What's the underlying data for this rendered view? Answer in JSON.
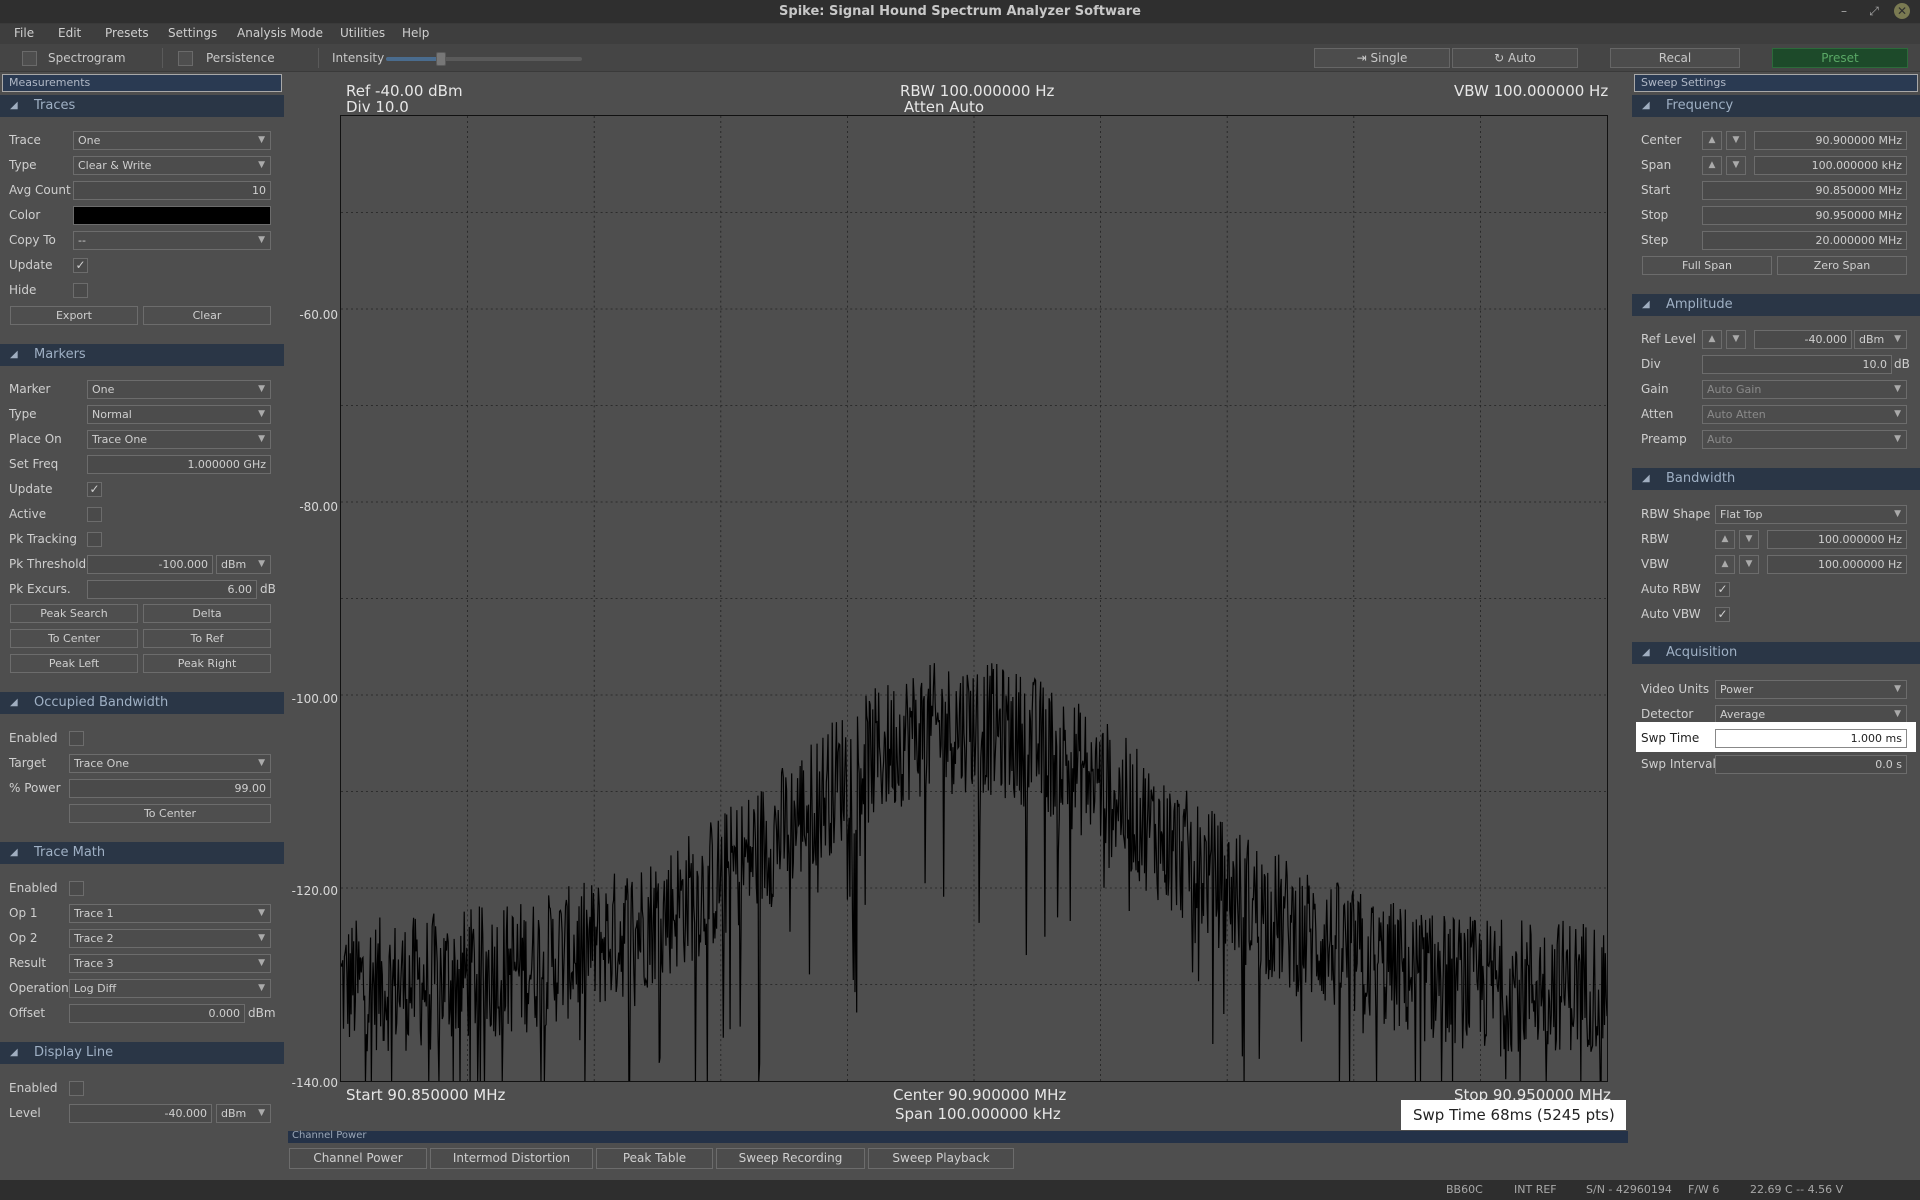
{
  "window": {
    "title": "Spike: Signal Hound Spectrum Analyzer Software"
  },
  "menu": [
    "File",
    "Edit",
    "Presets",
    "Settings",
    "Analysis Mode",
    "Utilities",
    "Help"
  ],
  "toolbar": {
    "spectrogram": "Spectrogram",
    "persistence": "Persistence",
    "intensity": "Intensity",
    "intensity_level": 0.28,
    "single": "Single",
    "auto": "Auto",
    "recal": "Recal",
    "preset": "Preset"
  },
  "left": {
    "tab": "Measurements",
    "traces": {
      "header": "Traces",
      "trace_label": "Trace",
      "trace": "One",
      "type_label": "Type",
      "type": "Clear & Write",
      "avg_label": "Avg Count",
      "avg": "10",
      "color_label": "Color",
      "copy_label": "Copy To",
      "copy": "--",
      "update_label": "Update",
      "hide_label": "Hide",
      "export": "Export",
      "clear": "Clear"
    },
    "markers": {
      "header": "Markers",
      "marker_label": "Marker",
      "marker": "One",
      "type_label": "Type",
      "type": "Normal",
      "place_label": "Place On",
      "place": "Trace One",
      "setfreq_label": "Set Freq",
      "setfreq": "1.000000 GHz",
      "update_label": "Update",
      "active_label": "Active",
      "pktrack_label": "Pk Tracking",
      "pkthresh_label": "Pk Threshold",
      "pkthresh": "-100.000",
      "pkthresh_unit": "dBm",
      "pkexc_label": "Pk Excurs.",
      "pkexc": "6.00",
      "pkexc_unit": "dB",
      "peak_search": "Peak Search",
      "delta": "Delta",
      "to_center": "To Center",
      "to_ref": "To Ref",
      "peak_left": "Peak Left",
      "peak_right": "Peak Right"
    },
    "obw": {
      "header": "Occupied Bandwidth",
      "enabled_label": "Enabled",
      "target_label": "Target",
      "target": "Trace One",
      "power_label": "% Power",
      "power": "99.00",
      "to_center": "To Center"
    },
    "tracemath": {
      "header": "Trace Math",
      "enabled_label": "Enabled",
      "op1_label": "Op 1",
      "op1": "Trace 1",
      "op2_label": "Op 2",
      "op2": "Trace 2",
      "result_label": "Result",
      "result": "Trace 3",
      "operation_label": "Operation",
      "operation": "Log Diff",
      "offset_label": "Offset",
      "offset": "0.000",
      "offset_unit": "dBm"
    },
    "displayline": {
      "header": "Display Line",
      "enabled_label": "Enabled",
      "level_label": "Level",
      "level": "-40.000",
      "level_unit": "dBm"
    }
  },
  "right": {
    "tab": "Sweep Settings",
    "frequency": {
      "header": "Frequency",
      "center_label": "Center",
      "center": "90.900000 MHz",
      "span_label": "Span",
      "span": "100.000000 kHz",
      "start_label": "Start",
      "start": "90.850000 MHz",
      "stop_label": "Stop",
      "stop": "90.950000 MHz",
      "step_label": "Step",
      "step": "20.000000 MHz",
      "full_span": "Full Span",
      "zero_span": "Zero Span"
    },
    "amplitude": {
      "header": "Amplitude",
      "ref_label": "Ref Level",
      "ref": "-40.000",
      "ref_unit": "dBm",
      "div_label": "Div",
      "div": "10.0",
      "div_unit": "dB",
      "gain_label": "Gain",
      "gain": "Auto Gain",
      "atten_label": "Atten",
      "atten": "Auto Atten",
      "preamp_label": "Preamp",
      "preamp": "Auto"
    },
    "bandwidth": {
      "header": "Bandwidth",
      "shape_label": "RBW Shape",
      "shape": "Flat Top",
      "rbw_label": "RBW",
      "rbw": "100.000000 Hz",
      "vbw_label": "VBW",
      "vbw": "100.000000 Hz",
      "autorbw_label": "Auto RBW",
      "autovbw_label": "Auto VBW"
    },
    "acquisition": {
      "header": "Acquisition",
      "video_label": "Video Units",
      "video": "Power",
      "detector_label": "Detector",
      "detector": "Average",
      "swptime_label": "Swp Time",
      "swptime": "1.000 ms",
      "swpint_label": "Swp Interval",
      "swpint": "0.0 s"
    }
  },
  "plot": {
    "ref": "Ref -40.00 dBm",
    "div": "Div 10.0",
    "rbw": "RBW 100.000000 Hz",
    "atten": "Atten Auto",
    "vbw": "VBW 100.000000 Hz",
    "start": "Start 90.850000 MHz",
    "center": "Center 90.900000 MHz",
    "span": "Span 100.000000 kHz",
    "stop": "Stop 90.950000 MHz",
    "swp_time": "Swp Time 68ms (5245 pts)",
    "y_ticks": [
      "-60.00",
      "-80.00",
      "-100.00",
      "-120.00",
      "-140.00"
    ]
  },
  "chart_data": {
    "type": "line",
    "x_range": [
      90.85,
      90.95
    ],
    "ylim": [
      -140,
      -40
    ],
    "grid": true,
    "series": [
      {
        "x": [
          90.85,
          90.855,
          90.86,
          90.865,
          90.87,
          90.875,
          90.88,
          90.885,
          90.89,
          90.895,
          90.9,
          90.905,
          90.91,
          90.915,
          90.92,
          90.925,
          90.93,
          90.935,
          90.94,
          90.945,
          90.95
        ],
        "values": [
          -130,
          -130,
          -129,
          -128,
          -126,
          -123,
          -119,
          -114,
          -108,
          -104,
          -103,
          -105,
          -109,
          -115,
          -120,
          -124,
          -127,
          -129,
          -130,
          -130,
          -130
        ]
      }
    ],
    "line_color": "#000000"
  },
  "bottom_tabs": {
    "strip": "Channel Power",
    "tabs": [
      "Channel Power",
      "Intermod Distortion",
      "Peak Table",
      "Sweep Recording",
      "Sweep Playback"
    ]
  },
  "status": {
    "device": "BB60C",
    "ref": "INT REF",
    "sn": "S/N - 42960194",
    "fw": "F/W 6",
    "temp": "22.69 C -- 4.56 V"
  }
}
